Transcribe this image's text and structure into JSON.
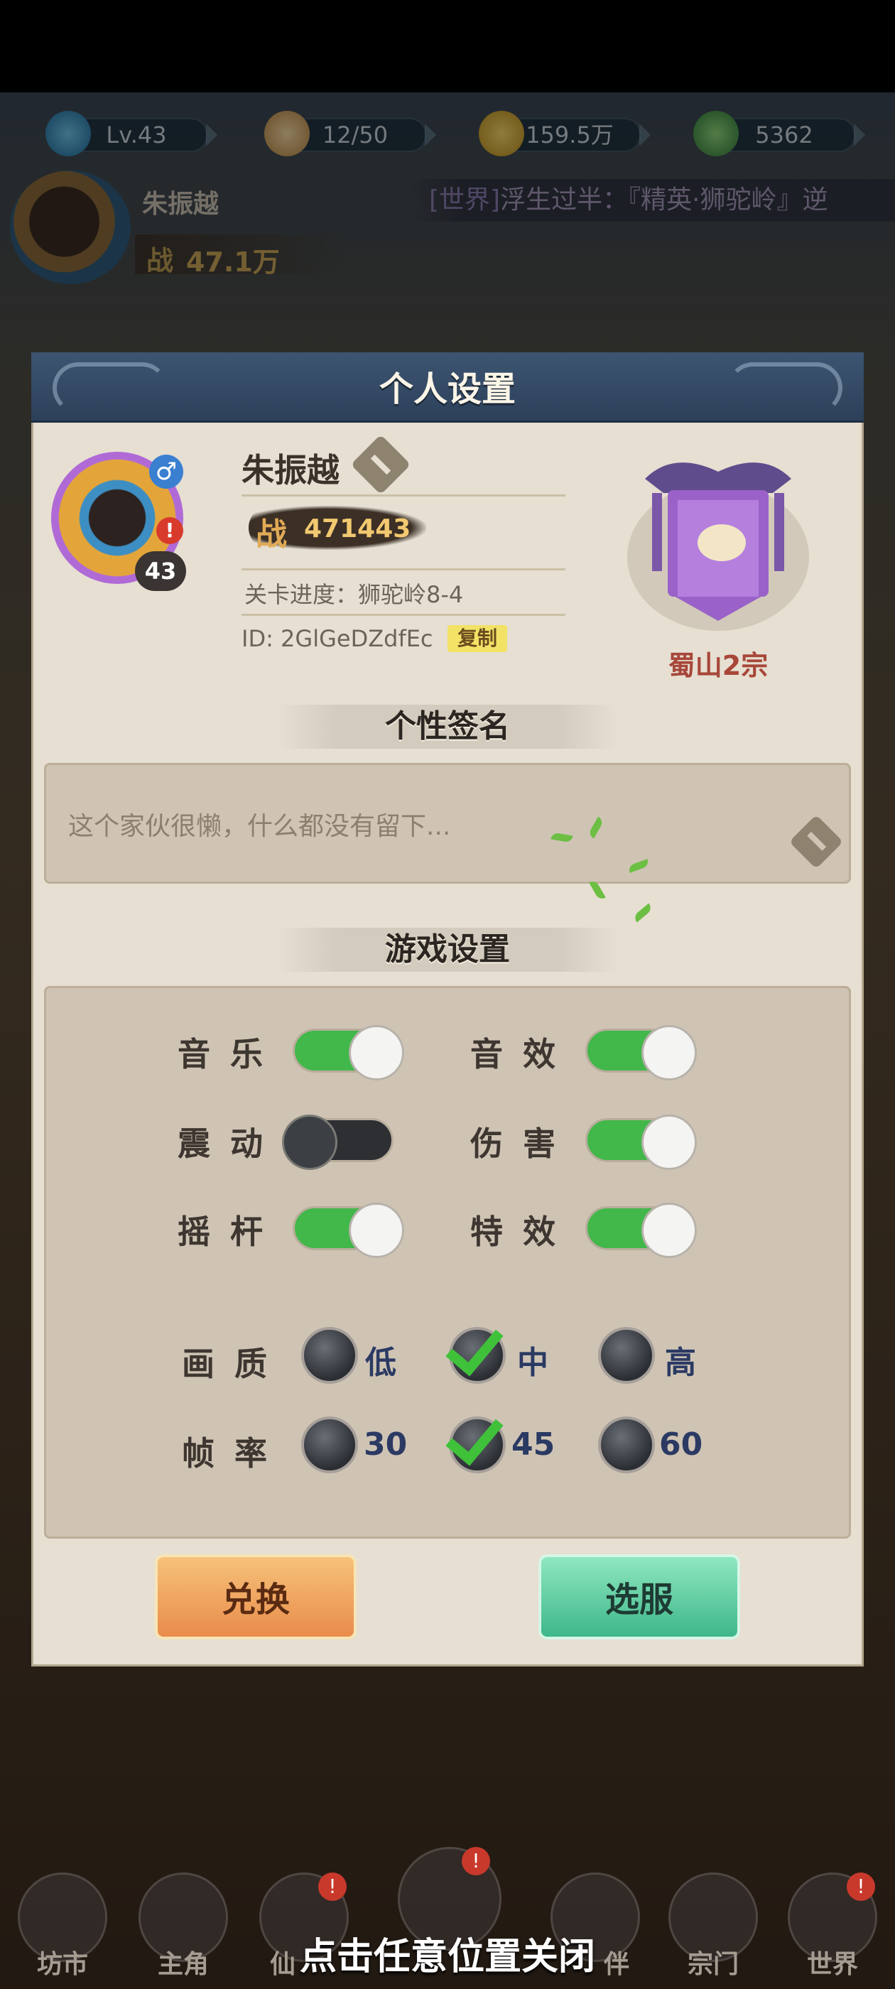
{
  "top_bar": {
    "level": "Lv.43",
    "stamina": "12/50",
    "coins": "159.5万",
    "jade": "5362"
  },
  "header": {
    "player_name": "朱振越",
    "power_label": "战",
    "power": "47.1万",
    "world_chat_tag": "[世界]",
    "world_chat_text": "浮生过半：『精英·狮驼岭』逆"
  },
  "dialog": {
    "title": "个人设置",
    "profile": {
      "name": "朱振越",
      "level": "43",
      "gender_symbol": "♂",
      "alert": "!",
      "power_label": "战",
      "power": "471443",
      "progress": "关卡进度：狮驼岭8-4",
      "id": "ID: 2GlGeDZdfEc",
      "copy_label": "复制",
      "sect_name": "蜀山2宗"
    },
    "signature_section": {
      "title": "个性签名",
      "text": "这个家伙很懒，什么都没有留下..."
    },
    "settings_section": {
      "title": "游戏设置",
      "toggles": [
        {
          "label": "音乐",
          "on": true
        },
        {
          "label": "音效",
          "on": true
        },
        {
          "label": "震动",
          "on": false
        },
        {
          "label": "伤害",
          "on": true
        },
        {
          "label": "摇杆",
          "on": true
        },
        {
          "label": "特效",
          "on": true
        }
      ],
      "quality": {
        "label": "画质",
        "options": [
          "低",
          "中",
          "高"
        ],
        "selected": "中"
      },
      "framerate": {
        "label": "帧率",
        "options": [
          "30",
          "45",
          "60"
        ],
        "selected": "45"
      }
    },
    "buttons": {
      "redeem": "兑换",
      "server": "选服"
    }
  },
  "bottom_nav": {
    "items": [
      "坊市",
      "主角",
      "仙",
      "伴",
      "宗门",
      "世界"
    ]
  },
  "close_hint": "点击任意位置关闭",
  "colors": {
    "toggle_on": "#42b74a",
    "toggle_off": "#2d2f33",
    "check": "#3fc13a",
    "sect_name": "#a7473a",
    "dialog_bg": "#e6dfd2"
  }
}
